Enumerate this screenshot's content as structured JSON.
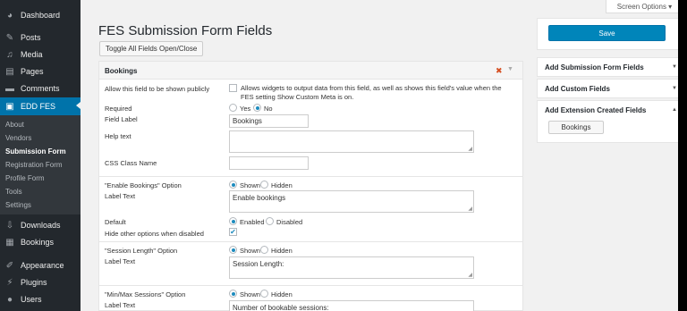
{
  "sidebar": {
    "menu": [
      {
        "label": "Dashboard",
        "icon": "dashboard-icon"
      },
      {
        "label": "Posts",
        "icon": "pin-icon"
      },
      {
        "label": "Media",
        "icon": "media-icon"
      },
      {
        "label": "Pages",
        "icon": "page-icon"
      },
      {
        "label": "Comments",
        "icon": "comment-icon"
      },
      {
        "label": "EDD FES",
        "icon": "form-icon"
      }
    ],
    "submenu": [
      "About",
      "Vendors",
      "Submission Form",
      "Registration Form",
      "Profile Form",
      "Tools",
      "Settings"
    ],
    "menu_lower": [
      {
        "label": "Downloads",
        "icon": "download-icon"
      },
      {
        "label": "Bookings",
        "icon": "calendar-icon"
      },
      {
        "label": "Appearance",
        "icon": "brush-icon"
      },
      {
        "label": "Plugins",
        "icon": "plug-icon"
      },
      {
        "label": "Users",
        "icon": "user-icon"
      }
    ]
  },
  "screen_options": "Screen Options ▾",
  "page_title": "FES Submission Form Fields",
  "toggle_button": "Toggle All Fields Open/Close",
  "field": {
    "title": "Bookings",
    "public_label": "Allow this field to be shown publicly",
    "public_desc": "Allows widgets to output data from this field, as well as shows this field's value when the FES setting Show Custom Meta is on.",
    "required_label": "Required",
    "required_yes": "Yes",
    "required_no": "No",
    "field_label_label": "Field Label",
    "field_label_value": "Bookings",
    "help_text_label": "Help text",
    "css_class_label": "CSS Class Name",
    "enable_option_label": "\"Enable Bookings\" Option",
    "enable_label_text_label": "Label Text",
    "enable_label_text_value": "Enable bookings",
    "default_label": "Default",
    "default_enabled": "Enabled",
    "default_disabled": "Disabled",
    "hide_label": "Hide other options when disabled",
    "session_option_label": "\"Session Length\" Option",
    "session_label_text_label": "Label Text",
    "session_label_text_value": "Session Length:",
    "minmax_option_label": "\"Min/Max Sessions\" Option",
    "minmax_label_text_label": "Label Text",
    "minmax_label_text_value": "Number of bookable sessions:",
    "shown": "Shown",
    "hidden": "Hidden"
  },
  "right_panel": {
    "save_button": "Save",
    "add_submission": "Add Submission Form Fields",
    "add_custom": "Add Custom Fields",
    "add_extension": "Add Extension Created Fields",
    "bookings_button": "Bookings"
  },
  "colors": {
    "accent": "#0073aa",
    "save": "#0085ba",
    "sidebar": "#23282d"
  }
}
